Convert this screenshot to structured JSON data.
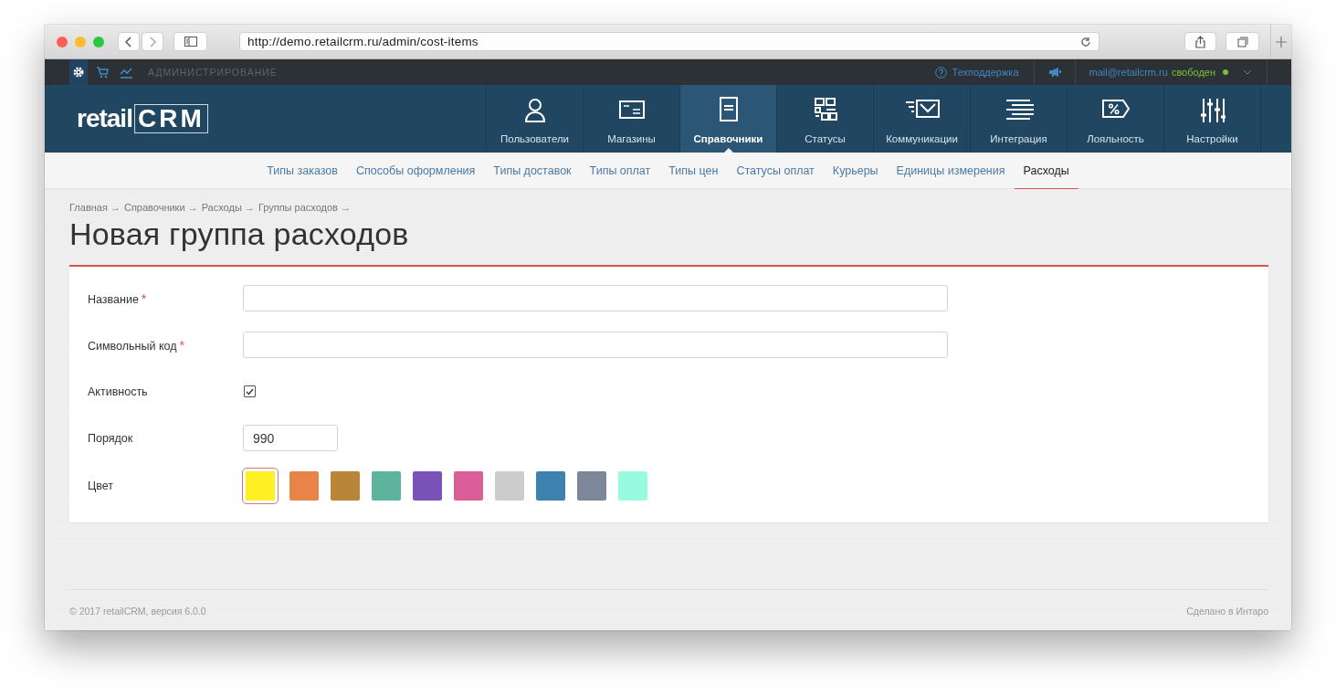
{
  "browser": {
    "url": "http://demo.retailcrm.ru/admin/cost-items"
  },
  "top_bar": {
    "section_label": "АДМИНИСТРИРОВАНИЕ",
    "tools": [
      {
        "selected": true
      },
      {
        "selected": false
      },
      {
        "selected": false
      }
    ],
    "support": "Техподдержка",
    "email": "mail@retailcrm.ru",
    "status": "свободен"
  },
  "logo": {
    "text": "retail",
    "boxed": "CRM"
  },
  "main_nav": [
    {
      "label": "Пользователи",
      "selected": false
    },
    {
      "label": "Магазины",
      "selected": false
    },
    {
      "label": "Справочники",
      "selected": true
    },
    {
      "label": "Статусы",
      "selected": false
    },
    {
      "label": "Коммуникации",
      "selected": false
    },
    {
      "label": "Интеграция",
      "selected": false
    },
    {
      "label": "Лояльность",
      "selected": false
    },
    {
      "label": "Настройки",
      "selected": false
    }
  ],
  "sub_nav": [
    {
      "label": "Типы заказов",
      "selected": false
    },
    {
      "label": "Способы оформления",
      "selected": false
    },
    {
      "label": "Типы доставок",
      "selected": false
    },
    {
      "label": "Типы оплат",
      "selected": false
    },
    {
      "label": "Типы цен",
      "selected": false
    },
    {
      "label": "Статусы оплат",
      "selected": false
    },
    {
      "label": "Курьеры",
      "selected": false
    },
    {
      "label": "Единицы измерения",
      "selected": false
    },
    {
      "label": "Расходы",
      "selected": true
    }
  ],
  "breadcrumbs": [
    "Главная →",
    "Справочники →",
    "Расходы →",
    "Группы расходов →"
  ],
  "page_title": "Новая группа расходов",
  "form": [
    {
      "kind": "text",
      "label": "Название",
      "required_mark": "*"
    },
    {
      "kind": "text",
      "label": "Символьный код",
      "required_mark": "*"
    },
    {
      "kind": "checkbox",
      "label": "Активность",
      "checked": true
    },
    {
      "kind": "number",
      "label": "Порядок",
      "value": "990"
    },
    {
      "kind": "colors",
      "label": "Цвет",
      "swatches": [
        {
          "color": "#fff024",
          "selected": true
        },
        {
          "color": "#e8834a",
          "selected": false
        },
        {
          "color": "#b98539",
          "selected": false
        },
        {
          "color": "#5eb39c",
          "selected": false
        },
        {
          "color": "#7a53b9",
          "selected": false
        },
        {
          "color": "#db5e98",
          "selected": false
        },
        {
          "color": "#cccccc",
          "selected": false
        },
        {
          "color": "#3e82b0",
          "selected": false
        },
        {
          "color": "#7c8899",
          "selected": false
        },
        {
          "color": "#98fadf",
          "selected": false
        }
      ]
    }
  ],
  "footer": {
    "copyright": "© 2017 retailCRM, версия 6.0.0",
    "credit": "Сделано в Интаро"
  }
}
